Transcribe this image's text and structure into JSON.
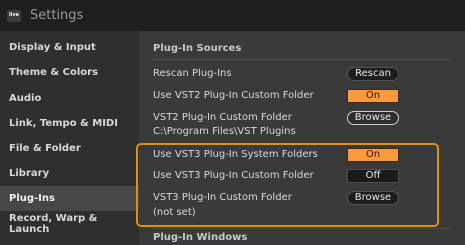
{
  "window": {
    "title": "Settings",
    "app_icon_text": "live"
  },
  "sidebar": {
    "items": [
      {
        "label": "Display & Input"
      },
      {
        "label": "Theme & Colors"
      },
      {
        "label": "Audio"
      },
      {
        "label": "Link, Tempo & MIDI"
      },
      {
        "label": "File & Folder"
      },
      {
        "label": "Library"
      },
      {
        "label": "Plug-Ins",
        "active": true
      },
      {
        "label": "Record, Warp & Launch"
      }
    ]
  },
  "main": {
    "section_plugin_sources": "Plug-In Sources",
    "rescan_label": "Rescan Plug-Ins",
    "rescan_button": "Rescan",
    "vst2_custom_label": "Use VST2 Plug-In Custom Folder",
    "vst2_custom_value": "On",
    "vst2_folder_label": "VST2 Plug-In Custom Folder",
    "vst2_folder_path": "C:\\Program Files\\VST Plugins",
    "vst2_browse": "Browse",
    "vst3_system_label": "Use VST3 Plug-In System Folders",
    "vst3_system_value": "On",
    "vst3_custom_label": "Use VST3 Plug-In Custom Folder",
    "vst3_custom_value": "Off",
    "vst3_folder_label": "VST3 Plug-In Custom Folder",
    "vst3_folder_path": "(not set)",
    "vst3_browse": "Browse",
    "section_plugin_windows": "Plug-In Windows"
  },
  "colors": {
    "accent": "#ff9a3c",
    "highlight": "#e08f12"
  }
}
